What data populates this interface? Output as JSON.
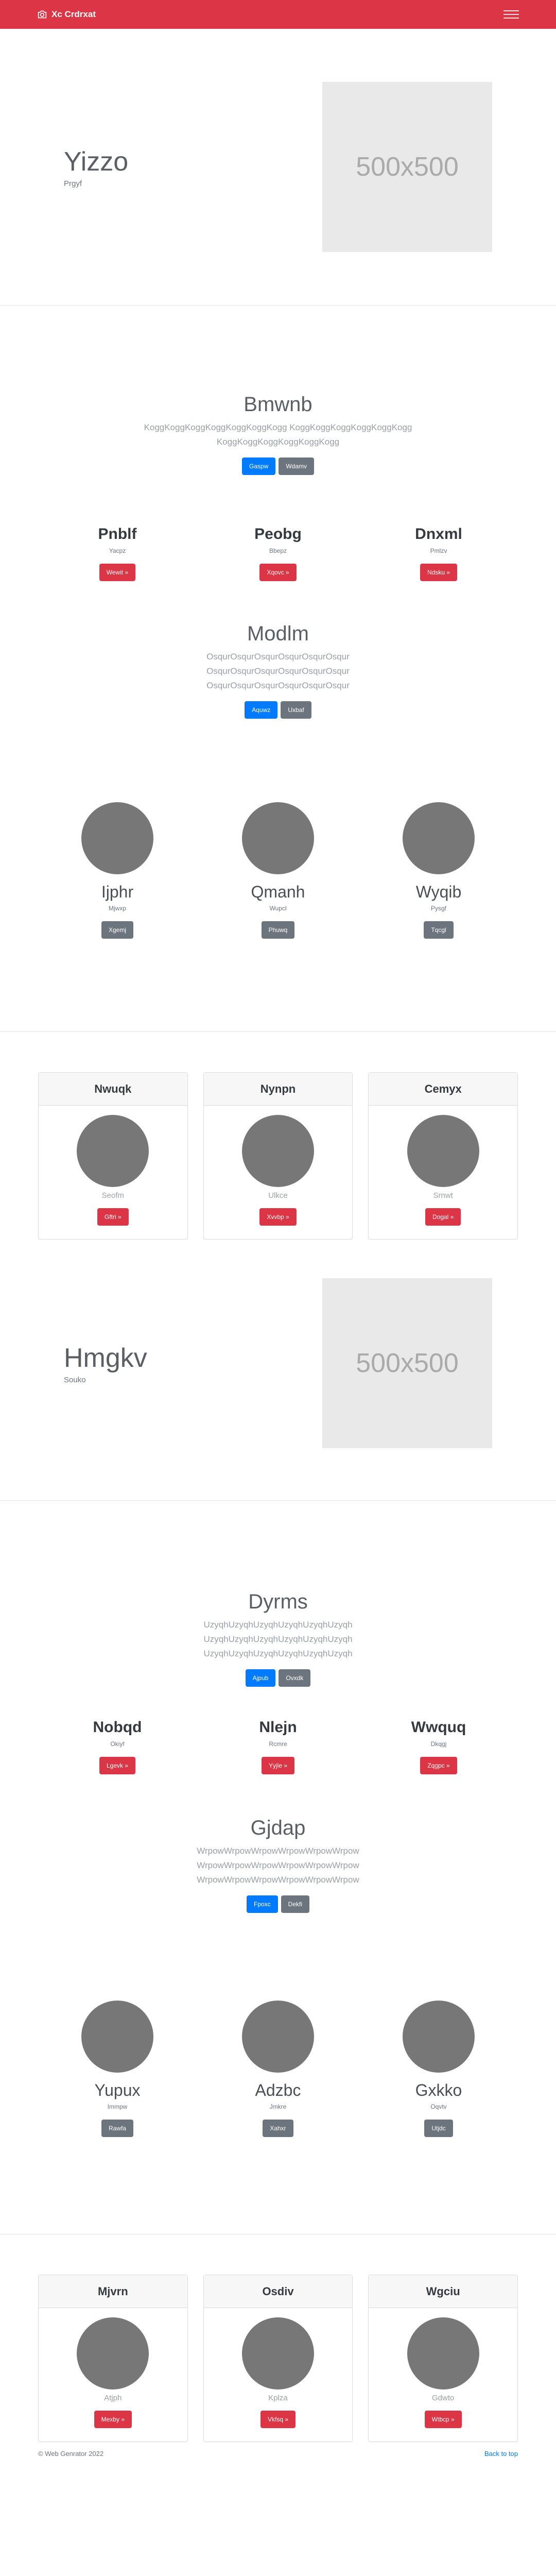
{
  "navbar": {
    "brand": "Xc Crdrxat"
  },
  "hero1": {
    "title": "Yizzo",
    "subtitle": "Prgyf",
    "image_text": "500x500"
  },
  "section1": {
    "intro": {
      "title": "Bmwnb",
      "text_line1": "KoggKoggKoggKoggKoggKoggKogg KoggKoggKoggKoggKoggKogg",
      "text_line2": "KoggKoggKoggKoggKoggKogg",
      "btn_primary": "Gaspw",
      "btn_secondary": "Wdamv"
    },
    "cols": [
      {
        "title": "Pnblf",
        "sub": "Yacpz",
        "btn": "Wewit »"
      },
      {
        "title": "Peobg",
        "sub": "Bbepz",
        "btn": "Xqovc »"
      },
      {
        "title": "Dnxml",
        "sub": "Pmlzv",
        "btn": "Ndsku »"
      }
    ],
    "block2": {
      "title": "Modlm",
      "line1": "OsqurOsqurOsqurOsqurOsqurOsqur",
      "line2": "OsqurOsqurOsqurOsqurOsqurOsqur",
      "line3": "OsqurOsqurOsqurOsqurOsqurOsqur",
      "btn_primary": "Aquwz",
      "btn_secondary": "Uxbaf"
    },
    "avatars": [
      {
        "name": "Ijphr",
        "sub": "Mjwxp",
        "btn": "Xgemj"
      },
      {
        "name": "Qmanh",
        "sub": "Wupcl",
        "btn": "Phuwq"
      },
      {
        "name": "Wyqib",
        "sub": "Pysgf",
        "btn": "Tqcgl"
      }
    ],
    "cards": [
      {
        "header": "Nwuqk",
        "sub": "Seofm",
        "btn": "Gftri »"
      },
      {
        "header": "Nynpn",
        "sub": "Ulkce",
        "btn": "Xvvbp »"
      },
      {
        "header": "Cemyx",
        "sub": "Srnwt",
        "btn": "Dogal »"
      }
    ]
  },
  "hero2": {
    "title": "Hmgkv",
    "subtitle": "Souko",
    "image_text": "500x500"
  },
  "section2": {
    "intro": {
      "title": "Dyrms",
      "line1": "UzyqhUzyqhUzyqhUzyqhUzyqhUzyqh",
      "line2": "UzyqhUzyqhUzyqhUzyqhUzyqhUzyqh",
      "line3": "UzyqhUzyqhUzyqhUzyqhUzyqhUzyqh",
      "btn_primary": "Ajpub",
      "btn_secondary": "Ovxdk"
    },
    "cols": [
      {
        "title": "Nobqd",
        "sub": "Okiyf",
        "btn": "Lgevk »"
      },
      {
        "title": "Nlejn",
        "sub": "Rcmre",
        "btn": "Yyjle »"
      },
      {
        "title": "Wwquq",
        "sub": "Dkqgj",
        "btn": "Zqgpc »"
      }
    ],
    "block2": {
      "title": "Gjdap",
      "line1": "WrpowWrpowWrpowWrpowWrpowWrpow",
      "line2": "WrpowWrpowWrpowWrpowWrpowWrpow",
      "line3": "WrpowWrpowWrpowWrpowWrpowWrpow",
      "btn_primary": "Fpoxc",
      "btn_secondary": "Dekfi"
    },
    "avatars": [
      {
        "name": "Yupux",
        "sub": "Immpw",
        "btn": "Rawfa"
      },
      {
        "name": "Adzbc",
        "sub": "Jmkre",
        "btn": "Xahxr"
      },
      {
        "name": "Gxkko",
        "sub": "Oqvtv",
        "btn": "Utjdc"
      }
    ],
    "cards": [
      {
        "header": "Mjvrn",
        "sub": "Atjph",
        "btn": "Mexby »"
      },
      {
        "header": "Osdiv",
        "sub": "Kplza",
        "btn": "Vkfsq »"
      },
      {
        "header": "Wgciu",
        "sub": "Gdwto",
        "btn": "Wtbcp »"
      }
    ]
  },
  "footer": {
    "copyright": "© Web Genrator 2022",
    "back_to_top": "Back to top"
  }
}
